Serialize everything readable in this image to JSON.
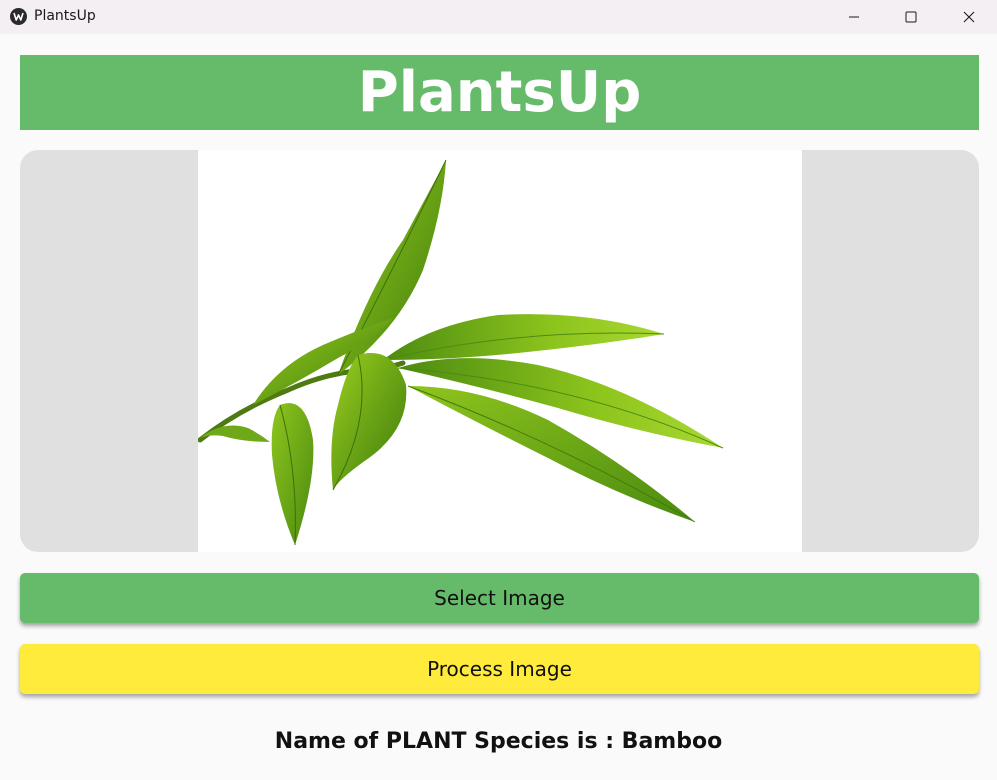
{
  "window": {
    "title": "PlantsUp",
    "icon": "kivy-app-icon",
    "controls": {
      "minimize_icon": "minimize-icon",
      "maximize_icon": "maximize-icon",
      "close_icon": "close-icon"
    }
  },
  "header": {
    "title": "PlantsUp",
    "background_color": "#66bb6a"
  },
  "image_panel": {
    "image": "bamboo-leaves-image",
    "panel_color": "#e0e0e0"
  },
  "buttons": {
    "select_label": "Select Image",
    "select_color": "#66bb6a",
    "process_label": "Process Image",
    "process_color": "#ffeb3b"
  },
  "result": {
    "text": "Name of PLANT Species is : Bamboo"
  }
}
